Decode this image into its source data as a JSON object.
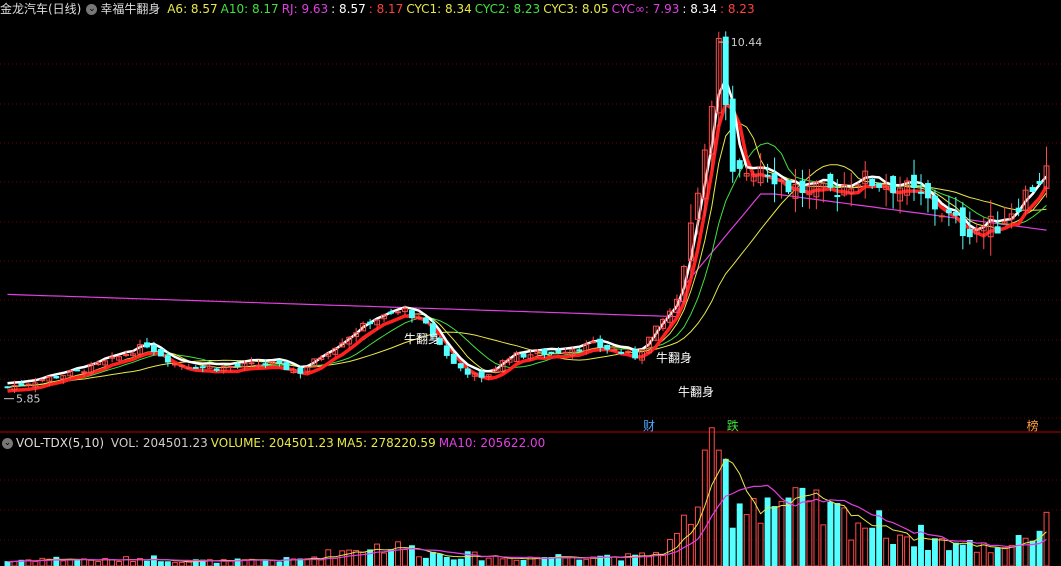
{
  "header": {
    "stock_title": "金龙汽车(日线)",
    "indicator_name": "幸福牛翻身",
    "items": [
      {
        "label": "A6: 8.57",
        "color": "#e8e84a"
      },
      {
        "label": "A10: 8.17",
        "color": "#41e141"
      },
      {
        "label": "RJ: 9.63",
        "color": "#e040e0"
      },
      {
        "label": ": 8.57",
        "color": "#ffffff"
      },
      {
        "label": ": 8.17",
        "color": "#ff4040"
      },
      {
        "label": "CYC1: 8.34",
        "color": "#e8e84a"
      },
      {
        "label": "CYC2: 8.23",
        "color": "#41e141"
      },
      {
        "label": "CYC3: 8.05",
        "color": "#e8e84a"
      },
      {
        "label": "CYC∞: 7.93",
        "color": "#e040e0"
      },
      {
        "label": ": 8.34",
        "color": "#ffffff"
      },
      {
        "label": ": 8.23",
        "color": "#ff4040"
      }
    ]
  },
  "vol_header": {
    "name": "VOL-TDX(5,10)",
    "items": [
      {
        "label": "VOL: 204501.23",
        "color": "#cccccc"
      },
      {
        "label": "VOLUME: 204501.23",
        "color": "#e8e84a"
      },
      {
        "label": "MA5: 278220.59",
        "color": "#e8e84a"
      },
      {
        "label": "MA10: 205622.00",
        "color": "#e040e0"
      }
    ]
  },
  "annotations": {
    "max_label": "10.44",
    "min_label": "5.85",
    "signal_text": "牛翻身",
    "flags": [
      {
        "text": "财",
        "color": "#4da6ff",
        "idx": 92
      },
      {
        "text": "跌",
        "color": "#41e141",
        "idx": 104
      },
      {
        "text": "榜",
        "color": "#ffa040",
        "idx": 147
      }
    ]
  },
  "colors": {
    "up": "#ff4a4a",
    "down": "#54ffff",
    "grid": "#6a0000",
    "separator": "#b40000"
  },
  "chart_data": {
    "type": "candlestick",
    "count": 150,
    "ylim": [
      5.6,
      10.7
    ],
    "vol_max": 600000,
    "keypoints": [
      {
        "i": 0,
        "close": 6.0,
        "vol": 25000
      },
      {
        "i": 5,
        "close": 6.1,
        "vol": 40000
      },
      {
        "i": 10,
        "close": 6.2,
        "vol": 35000
      },
      {
        "i": 15,
        "close": 6.35,
        "vol": 30000
      },
      {
        "i": 20,
        "close": 6.55,
        "vol": 45000
      },
      {
        "i": 24,
        "close": 6.3,
        "vol": 30000
      },
      {
        "i": 30,
        "close": 6.25,
        "vol": 25000
      },
      {
        "i": 38,
        "close": 6.3,
        "vol": 30000
      },
      {
        "i": 42,
        "close": 6.2,
        "vol": 35000
      },
      {
        "i": 48,
        "close": 6.6,
        "vol": 80000
      },
      {
        "i": 52,
        "close": 6.85,
        "vol": 110000
      },
      {
        "i": 57,
        "close": 7.0,
        "vol": 100000
      },
      {
        "i": 60,
        "close": 6.8,
        "vol": 70000
      },
      {
        "i": 64,
        "close": 6.3,
        "vol": 60000
      },
      {
        "i": 68,
        "close": 6.1,
        "vol": 50000
      },
      {
        "i": 72,
        "close": 6.4,
        "vol": 45000
      },
      {
        "i": 78,
        "close": 6.45,
        "vol": 50000
      },
      {
        "i": 84,
        "close": 6.55,
        "vol": 60000
      },
      {
        "i": 90,
        "close": 6.4,
        "vol": 45000
      },
      {
        "i": 93,
        "close": 6.75,
        "vol": 70000
      },
      {
        "i": 96,
        "close": 7.1,
        "vol": 150000
      },
      {
        "i": 100,
        "close": 9.1,
        "vol": 450000
      },
      {
        "i": 102,
        "close": 10.44,
        "vol": 600000
      },
      {
        "i": 104,
        "close": 8.7,
        "vol": 350000
      },
      {
        "i": 108,
        "close": 8.9,
        "vol": 380000
      },
      {
        "i": 112,
        "close": 8.6,
        "vol": 330000
      },
      {
        "i": 117,
        "close": 8.5,
        "vol": 280000
      },
      {
        "i": 122,
        "close": 8.7,
        "vol": 250000
      },
      {
        "i": 128,
        "close": 8.6,
        "vol": 180000
      },
      {
        "i": 133,
        "close": 8.35,
        "vol": 140000
      },
      {
        "i": 137,
        "close": 8.05,
        "vol": 110000
      },
      {
        "i": 142,
        "close": 8.1,
        "vol": 100000
      },
      {
        "i": 145,
        "close": 8.4,
        "vol": 160000
      },
      {
        "i": 149,
        "close": 8.8,
        "vol": 204501
      }
    ],
    "cyc_inf_start": 7.2,
    "cyc_inf_end": 9.63
  }
}
